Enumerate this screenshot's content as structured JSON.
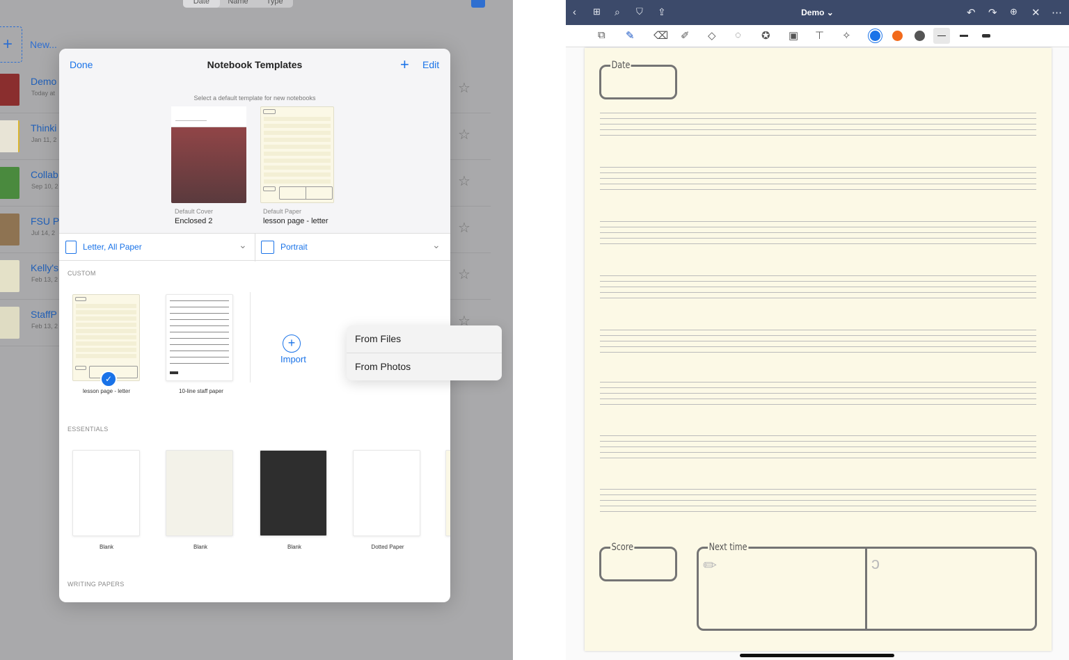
{
  "library": {
    "sort_tabs": [
      "Date",
      "Name",
      "Type"
    ],
    "new_label": "New...",
    "items": [
      {
        "title": "Demo",
        "date": "Today at",
        "color": "#8a2e2e"
      },
      {
        "title": "Thinki",
        "date": "Jan 11, 2",
        "color": "#e8e4d6"
      },
      {
        "title": "Collab",
        "date": "Sep 10, 2",
        "color": "#4a8a3e"
      },
      {
        "title": "FSU P",
        "date": "Jul 14, 2",
        "color": "#8e7352"
      },
      {
        "title": "Kelly's",
        "date": "Feb 13, 2",
        "color": "#e4e1c8"
      },
      {
        "title": "StaffP",
        "date": "Feb 13, 2",
        "color": "#dfdcc3"
      }
    ]
  },
  "modal": {
    "done_label": "Done",
    "title": "Notebook Templates",
    "edit_label": "Edit",
    "select_hint": "Select a default template for new notebooks",
    "default_cover_caption": "Default Cover",
    "default_cover_name": "Enclosed 2",
    "default_paper_caption": "Default Paper",
    "default_paper_name": "lesson page - letter",
    "paper_size": "Letter, All Paper",
    "orientation": "Portrait",
    "custom_header": "CUSTOM",
    "custom_templates": [
      "lesson page - letter",
      "10-line staff paper"
    ],
    "import_label": "Import",
    "import_menu": [
      "From Files",
      "From Photos"
    ],
    "essentials_header": "ESSENTIALS",
    "essentials": [
      "Blank",
      "Blank",
      "Blank",
      "Dotted Paper"
    ],
    "writing_header": "WRITING PAPERS"
  },
  "editor": {
    "title": "Demo",
    "colors": [
      "#1a73e8",
      "#f26a1b",
      "#555555"
    ],
    "labels": {
      "date": "Date",
      "score": "Score",
      "next_time": "Next time"
    }
  }
}
